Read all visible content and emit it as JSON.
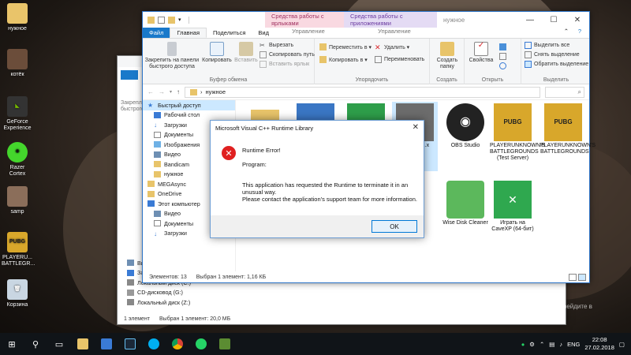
{
  "desktop": {
    "icons": [
      {
        "label": "нужное",
        "color": "#e9c46a"
      },
      {
        "label": "котёк",
        "color": "#6b4d3a"
      },
      {
        "label": "GeForce Experience",
        "color": "#333"
      },
      {
        "label": "Razer Cortex",
        "color": "#44d62c"
      },
      {
        "label": "samp",
        "color": "#8b6e5a"
      },
      {
        "label": "PLAYERU... BATTLEGR...",
        "color": "#d8a72b"
      },
      {
        "label": "Корзина",
        "color": "#c9d6e2"
      }
    ]
  },
  "explorer_back": {
    "nav": [
      "Закреплен быстрого",
      "Видео",
      "Загрузки",
      "Локальный диск (C:)",
      "CD-дисковод (G:)",
      "Локальный диск (Z:)"
    ],
    "status_count": "1 элемент",
    "status_sel": "Выбран 1 элемент: 20,0 МБ"
  },
  "explorer": {
    "ctx_tab1": "Средства работы с ярлыками",
    "ctx_tab2": "Средства работы с приложениями",
    "title": "нужное",
    "menu": {
      "file": "Файл",
      "home": "Главная",
      "share": "Поделиться",
      "view": "Вид",
      "manage1": "Управление",
      "manage2": "Управление"
    },
    "ribbon": {
      "pin": "Закрепить на панели быстрого доступа",
      "copy": "Копировать",
      "paste": "Вставить",
      "cut": "Вырезать",
      "copy_path": "Скопировать путь",
      "paste_shortcut": "Вставить ярлык",
      "group_clipboard": "Буфер обмена",
      "move_to": "Переместить в ▾",
      "copy_to": "Копировать в ▾",
      "delete": "Удалить ▾",
      "rename": "Переименовать",
      "group_organize": "Упорядочить",
      "new_folder": "Создать папку",
      "group_create": "Создать",
      "properties": "Свойства",
      "group_open": "Открыть",
      "select_all": "Выделить все",
      "select_none": "Снять выделение",
      "invert": "Обратить выделение",
      "group_select": "Выделить"
    },
    "address": "нужное",
    "nav": {
      "quick_access": "Быстрый доступ",
      "items": [
        "Рабочий стол",
        "Загрузки",
        "Документы",
        "Изображения",
        "Видео",
        "Bandicam",
        "нужное",
        "MEGAsync",
        "OneDrive",
        "Этот компьютер",
        "Видео",
        "Документы",
        "Загрузки"
      ]
    },
    "files": [
      {
        "label": "",
        "color": "#e8c46a"
      },
      {
        "label": "",
        "color": "#3a76c4"
      },
      {
        "label": "",
        "color": "#2e9e4a"
      },
      {
        "label": "...aunch ...x",
        "color": "#6c6c6c"
      },
      {
        "label": "OBS Studio",
        "color": "#222"
      },
      {
        "label": "PLAYERUNKNOWN'S BATTLEGROUNDS (Test Server)",
        "color": "#d8a72b"
      },
      {
        "label": "PLAYERUNKNOWN'S BATTLEGROUNDS",
        "color": "#d8a72b"
      },
      {
        "label": "Wise Disk Cleaner",
        "color": "#5cb85c"
      },
      {
        "label": "Играть на CaveXP (64-бит)",
        "color": "#2fa84f"
      }
    ],
    "status_count": "Элементов: 13",
    "status_sel": "Выбран 1 элемент: 1,16 КБ"
  },
  "dialog": {
    "title": "Microsoft Visual C++ Runtime Library",
    "error": "Runtime Error!",
    "program": "Program:",
    "message1": "This application has requested the Runtime to terminate it in an",
    "message2": "unusual way.",
    "message3": "Please contact the application's support team for more information.",
    "ok": "OK"
  },
  "activation": {
    "heading": "Активация Windows",
    "line1": "Чтобы активировать Windows, перейдите в",
    "line2": "раздел \"Параметры\"."
  },
  "taskbar": {
    "lang": "ENG",
    "time": "22:08",
    "date": "27.02.2018"
  }
}
